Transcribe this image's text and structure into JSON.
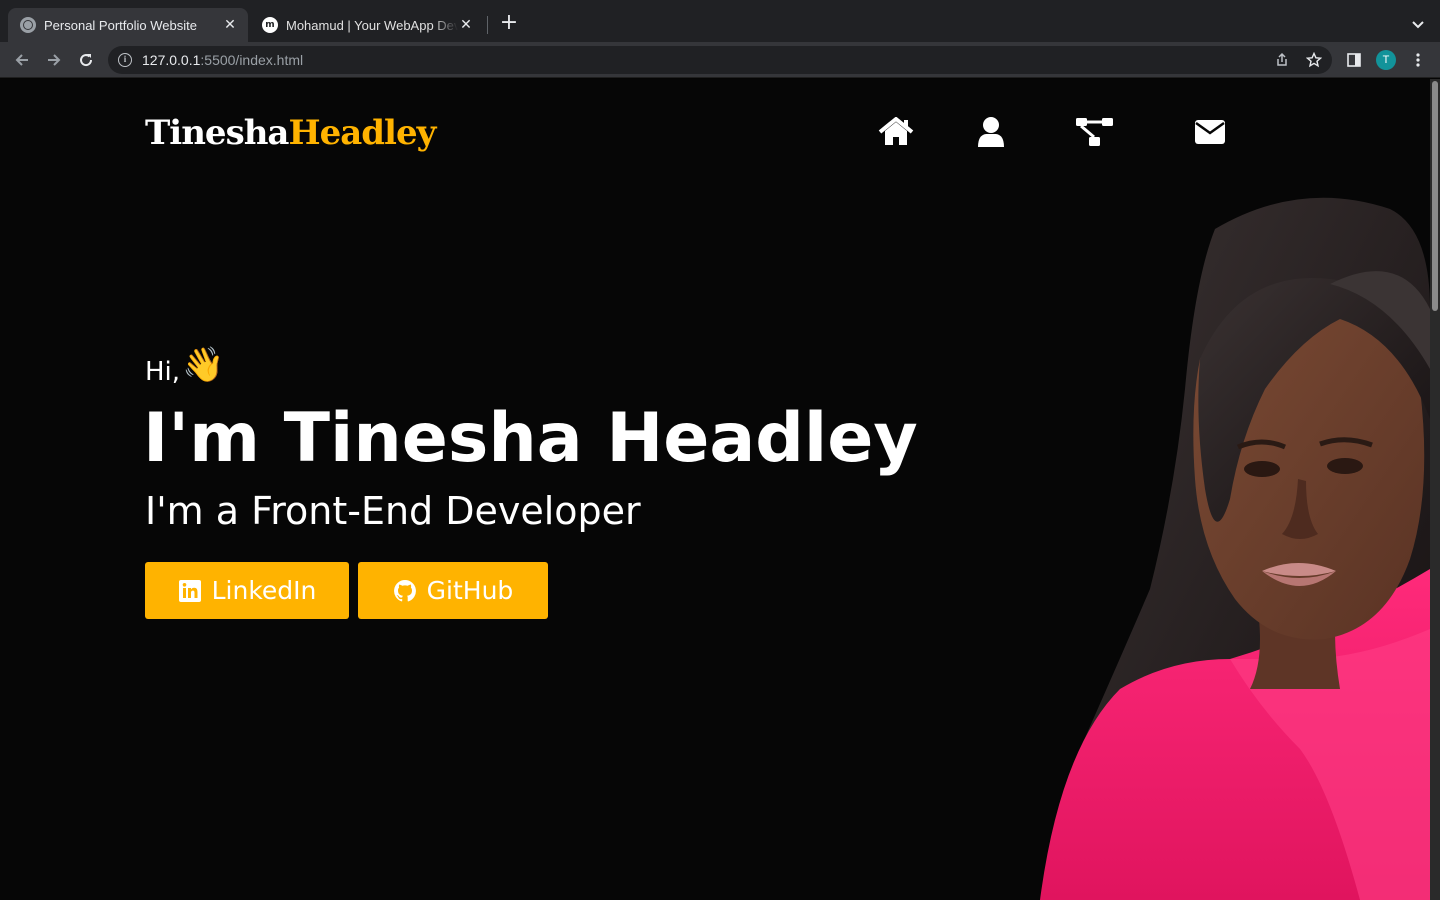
{
  "browser": {
    "tabs": [
      {
        "title": "Personal Portfolio Website",
        "active": true,
        "favicon": "globe-icon"
      },
      {
        "title": "Mohamud | Your WebApp Deve",
        "active": false,
        "favicon": "m-logo-icon"
      }
    ],
    "url_host": "127.0.0.1",
    "url_rest": ":5500/index.html",
    "profile_initial": "T"
  },
  "site": {
    "logo_first": "Tinesha",
    "logo_last": "Headley",
    "nav": [
      {
        "icon": "home-icon"
      },
      {
        "icon": "user-icon"
      },
      {
        "icon": "sitemap-icon"
      },
      {
        "icon": "envelope-icon"
      }
    ],
    "hero": {
      "greeting": "Hi,",
      "wave": "👋",
      "headline": "I'm Tinesha Headley",
      "subline": "I'm a Front-End Developer",
      "linkedin_label": "LinkedIn",
      "github_label": "GitHub"
    },
    "colors": {
      "accent": "#ffb300",
      "background": "#060606",
      "text": "#ffffff"
    }
  }
}
